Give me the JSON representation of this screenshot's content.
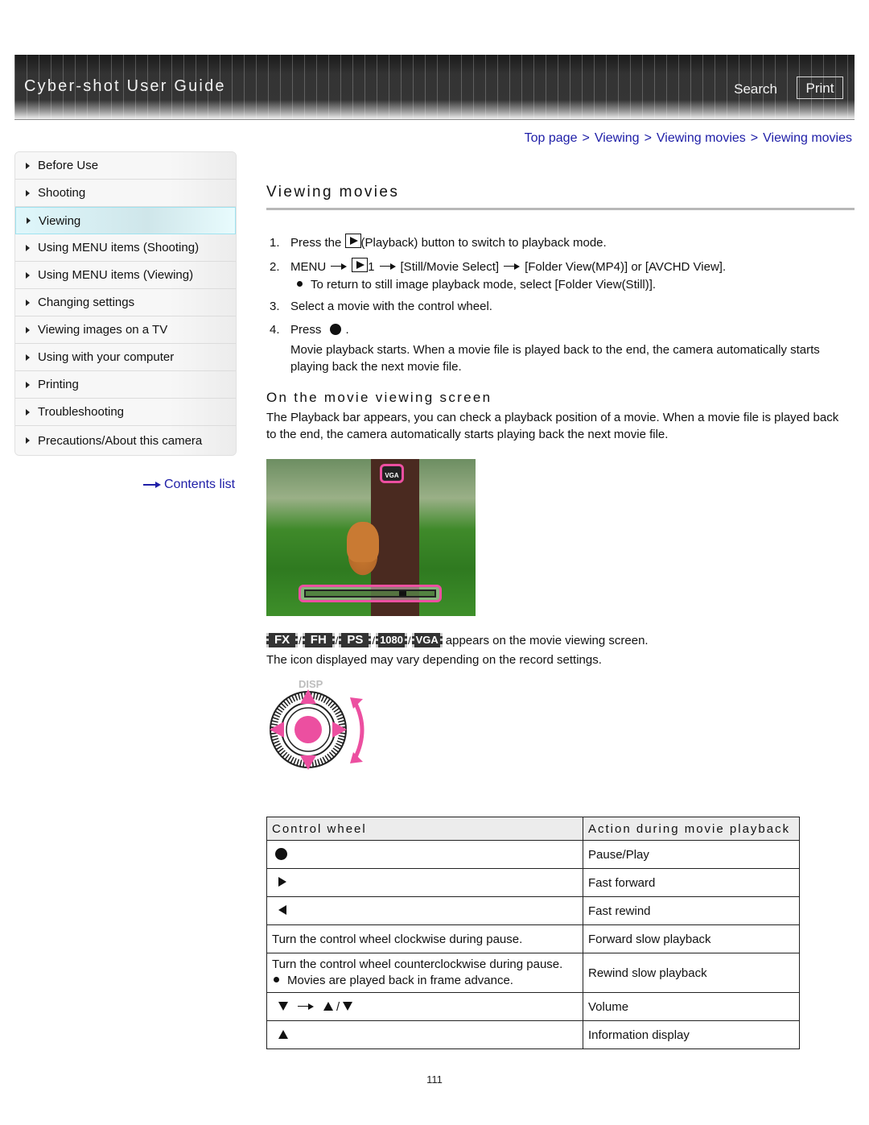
{
  "header": {
    "title": "Cyber-shot User Guide",
    "search_label": "Search",
    "print_label": "Print"
  },
  "breadcrumb": [
    "Top page",
    "Viewing",
    "Viewing movies",
    "Viewing movies"
  ],
  "breadcrumb_separator": ">",
  "sidebar": {
    "items": [
      {
        "label": "Before Use",
        "active": false
      },
      {
        "label": "Shooting",
        "active": false
      },
      {
        "label": "Viewing",
        "active": true
      },
      {
        "label": "Using MENU items (Shooting)",
        "active": false
      },
      {
        "label": "Using MENU items (Viewing)",
        "active": false
      },
      {
        "label": "Changing settings",
        "active": false
      },
      {
        "label": "Viewing images on a TV",
        "active": false
      },
      {
        "label": "Using with your computer",
        "active": false
      },
      {
        "label": "Printing",
        "active": false
      },
      {
        "label": "Troubleshooting",
        "active": false
      },
      {
        "label": "Precautions/About this camera",
        "active": false
      }
    ],
    "contents_link": "Contents list",
    "active_color": "#dff7fb"
  },
  "main": {
    "title": "Viewing movies",
    "steps": {
      "s1_num": "1.",
      "s1_pre": "Press the",
      "s1_post": "(Playback) button to switch to playback mode.",
      "s2_num": "2.",
      "s2_menu": "MENU",
      "s2_tab": "1",
      "s2_select": "[Still/Movie Select]",
      "s2_end": "[Folder View(MP4)] or [AVCHD View].",
      "s2_note": "To return to still image playback mode, select [Folder View(Still)].",
      "s3_num": "3.",
      "s3_text": "Select a movie with the control wheel.",
      "s4_num": "4.",
      "s4_pre": "Press",
      "s4_post": ".",
      "s4_desc": "Movie playback starts. When a movie file is played back to the end, the camera automatically starts playing back the next movie file."
    },
    "section_title": "On the movie viewing screen",
    "section_para": "The Playback bar appears, you can check a playback position of a movie. When a movie file is played back to the end, the camera automatically starts playing back the next movie file.",
    "photo": {
      "overlay_badge": "VGA",
      "playback_position": 0.75,
      "highlight_color": "#ec4fa0"
    },
    "badges": [
      "FX",
      "FH",
      "PS",
      "1080",
      "VGA"
    ],
    "badges_suffix": "appears on the movie viewing screen.",
    "badges_note": "The icon displayed may vary depending on the record settings.",
    "wheel": {
      "label": "DISP",
      "accent_color": "#ec4fa0"
    },
    "table": {
      "headers": [
        "Control wheel",
        "Action during movie playback"
      ],
      "rows": [
        {
          "control": "",
          "control_icon": "center-button",
          "action": "Pause/Play"
        },
        {
          "control": "",
          "control_icon": "right",
          "action": "Fast forward"
        },
        {
          "control": "",
          "control_icon": "left",
          "action": "Fast rewind"
        },
        {
          "control": "Turn the control wheel clockwise during pause.",
          "action": "Forward slow playback"
        },
        {
          "control": "Turn the control wheel counterclockwise during pause.",
          "control_note": "Movies are played back in frame advance.",
          "action": "Rewind slow playback"
        },
        {
          "control": "",
          "control_icon": "down-then-up-down",
          "control_sep": "/",
          "action": "Volume"
        },
        {
          "control": "",
          "control_icon": "up",
          "action": "Information display"
        }
      ]
    }
  },
  "page_number": "111"
}
